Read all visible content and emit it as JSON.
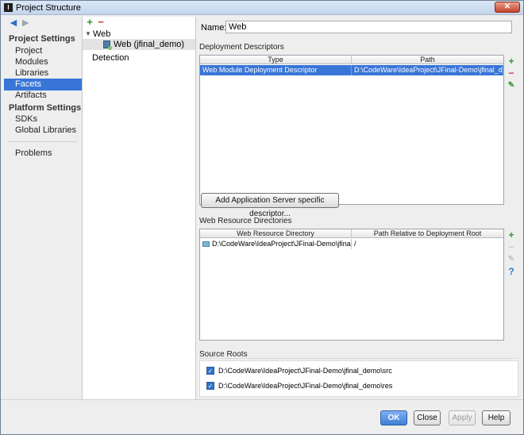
{
  "window": {
    "title": "Project Structure",
    "close_glyph": "✕"
  },
  "nav": {
    "back_glyph": "◀",
    "forward_glyph": "▶",
    "groups": [
      {
        "label": "Project Settings"
      },
      {
        "label": "Platform Settings"
      }
    ],
    "items": [
      {
        "label": "Project"
      },
      {
        "label": "Modules"
      },
      {
        "label": "Libraries"
      },
      {
        "label": "Facets"
      },
      {
        "label": "Artifacts"
      },
      {
        "label": "SDKs"
      },
      {
        "label": "Global Libraries"
      },
      {
        "label": "Problems"
      }
    ]
  },
  "tree": {
    "add_glyph": "+",
    "remove_glyph": "−",
    "rows": [
      {
        "label": "Web",
        "toggle": "▼"
      },
      {
        "label": "Web (jfinal_demo)"
      },
      {
        "label": "Detection"
      }
    ]
  },
  "name_field": {
    "label": "Name:",
    "value": "Web"
  },
  "deployment": {
    "section_title": "Deployment Descriptors",
    "columns": [
      "Type",
      "Path"
    ],
    "rows": [
      {
        "type": "Web Module Deployment Descriptor",
        "path": "D:\\CodeWare\\IdeaProject\\JFinal-Demo\\jfinal_demo"
      }
    ],
    "add_server_button": "Add Application Server specific descriptor..."
  },
  "web_resources": {
    "section_title": "Web Resource Directories",
    "columns": [
      "Web Resource Directory",
      "Path Relative to Deployment Root"
    ],
    "rows": [
      {
        "directory": "D:\\CodeWare\\IdeaProject\\JFinal-Demo\\jfinal_...",
        "relative": "/"
      }
    ]
  },
  "side_tools": {
    "plus": "+",
    "minus": "−",
    "edit": "✎",
    "help": "?"
  },
  "source_roots": {
    "section_title": "Source Roots",
    "check_glyph": "✓",
    "items": [
      {
        "path": "D:\\CodeWare\\IdeaProject\\JFinal-Demo\\jfinal_demo\\src",
        "checked": true
      },
      {
        "path": "D:\\CodeWare\\IdeaProject\\JFinal-Demo\\jfinal_demo\\res",
        "checked": true
      }
    ]
  },
  "footer": {
    "ok": "OK",
    "close": "Close",
    "apply": "Apply",
    "help": "Help"
  }
}
